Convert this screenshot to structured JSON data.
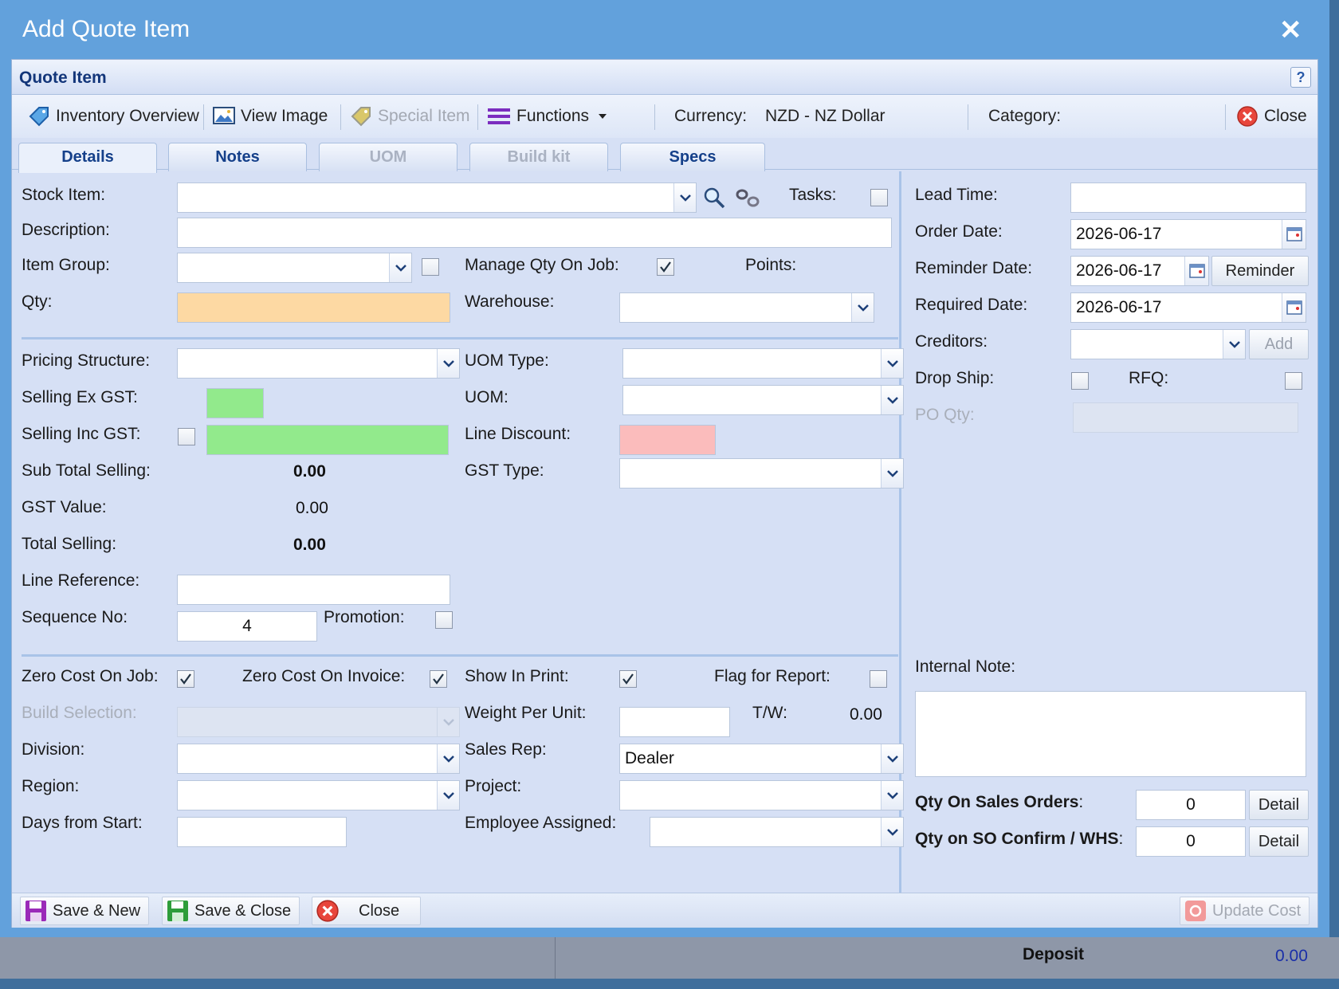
{
  "dialog": {
    "title": "Add Quote Item",
    "close_symbol": "✕"
  },
  "panel": {
    "title": "Quote Item",
    "help": "?"
  },
  "toolbar": {
    "inventory_overview": "Inventory Overview",
    "view_image": "View Image",
    "special_item": "Special Item",
    "functions": "Functions",
    "currency_label": "Currency:",
    "currency_value": "NZD - NZ Dollar",
    "category_label": "Category:",
    "close": "Close"
  },
  "tabs": [
    {
      "label": "Details",
      "active": true,
      "enabled": true
    },
    {
      "label": "Notes",
      "active": false,
      "enabled": true
    },
    {
      "label": "UOM",
      "active": false,
      "enabled": false
    },
    {
      "label": "Build kit",
      "active": false,
      "enabled": false
    },
    {
      "label": "Specs",
      "active": false,
      "enabled": true
    }
  ],
  "form": {
    "stock_item": {
      "label": "Stock Item:",
      "value": ""
    },
    "tasks": {
      "label": "Tasks:",
      "checked": false
    },
    "description": {
      "label": "Description:",
      "value": ""
    },
    "item_group": {
      "label": "Item Group:",
      "value": "",
      "checked": false
    },
    "manage_qty_on_job": {
      "label": "Manage Qty On Job:",
      "checked": true
    },
    "points": {
      "label": "Points:"
    },
    "qty": {
      "label": "Qty:",
      "value": ""
    },
    "warehouse": {
      "label": "Warehouse:",
      "value": ""
    },
    "pricing_structure": {
      "label": "Pricing Structure:",
      "value": ""
    },
    "uom_type": {
      "label": "UOM Type:",
      "value": ""
    },
    "selling_ex_gst": {
      "label": "Selling Ex GST:",
      "value": ""
    },
    "uom": {
      "label": "UOM:",
      "value": ""
    },
    "selling_inc_gst": {
      "label": "Selling Inc GST:",
      "value": "",
      "checked": false
    },
    "line_discount": {
      "label": "Line Discount:",
      "value": ""
    },
    "sub_total_selling": {
      "label": "Sub Total Selling:",
      "value": "0.00"
    },
    "gst_type": {
      "label": "GST Type:",
      "value": ""
    },
    "gst_value": {
      "label": "GST Value:",
      "value": "0.00"
    },
    "total_selling": {
      "label": "Total Selling:",
      "value": "0.00"
    },
    "line_reference": {
      "label": "Line Reference:",
      "value": ""
    },
    "sequence_no": {
      "label": "Sequence No:",
      "value": "4"
    },
    "promotion": {
      "label": "Promotion:",
      "checked": false
    },
    "zero_cost_on_job": {
      "label": "Zero Cost On Job:",
      "checked": true
    },
    "zero_cost_on_invoice": {
      "label": "Zero Cost On Invoice:",
      "checked": true
    },
    "show_in_print": {
      "label": "Show In Print:",
      "checked": true
    },
    "flag_for_report": {
      "label": "Flag for Report:",
      "checked": false
    },
    "build_selection": {
      "label": "Build Selection:",
      "value": ""
    },
    "weight_per_unit": {
      "label": "Weight Per Unit:",
      "value": ""
    },
    "tw": {
      "label": "T/W:",
      "value": "0.00"
    },
    "division": {
      "label": "Division:",
      "value": ""
    },
    "sales_rep": {
      "label": "Sales Rep:",
      "value": "Dealer"
    },
    "region": {
      "label": "Region:",
      "value": ""
    },
    "project": {
      "label": "Project:",
      "value": ""
    },
    "days_from_start": {
      "label": "Days from Start:",
      "value": ""
    },
    "employee_assigned": {
      "label": "Employee Assigned:",
      "value": ""
    },
    "lead_time": {
      "label": "Lead Time:",
      "value": ""
    },
    "order_date": {
      "label": "Order Date:",
      "value": "2026-06-17"
    },
    "reminder_date": {
      "label": "Reminder Date:",
      "value": "2026-06-17"
    },
    "reminder_button": "Reminder",
    "required_date": {
      "label": "Required Date:",
      "value": "2026-06-17"
    },
    "creditors": {
      "label": "Creditors:",
      "value": ""
    },
    "add_button": "Add",
    "drop_ship": {
      "label": "Drop Ship:",
      "checked": false
    },
    "rfq": {
      "label": "RFQ:",
      "checked": false
    },
    "po_qty": {
      "label": "PO Qty:",
      "value": ""
    },
    "internal_note": {
      "label": "Internal Note:",
      "value": ""
    },
    "qty_on_sales_orders": {
      "label": "Qty On Sales Orders",
      "colon": ":",
      "value": "0",
      "button": "Detail"
    },
    "qty_on_so_confirm": {
      "label": "Qty on SO Confirm / WHS",
      "colon": ":",
      "value": "0",
      "button": "Detail"
    }
  },
  "footer": {
    "save_new": "Save & New",
    "save_close": "Save & Close",
    "close": "Close",
    "update_cost": "Update Cost"
  },
  "background": {
    "deposit_label": "Deposit",
    "deposit_value": "0.00"
  },
  "colors": {
    "dialog": "#62a1dc",
    "panel": "#d6e0f5",
    "qty_bg": "#fdd9a3",
    "selling_bg": "#92ea8c",
    "discount_bg": "#fbbcbc",
    "close_icon": "#e8463c",
    "save_icon_purple": "#9a2ab8",
    "save_icon_green": "#2e9d3a"
  }
}
